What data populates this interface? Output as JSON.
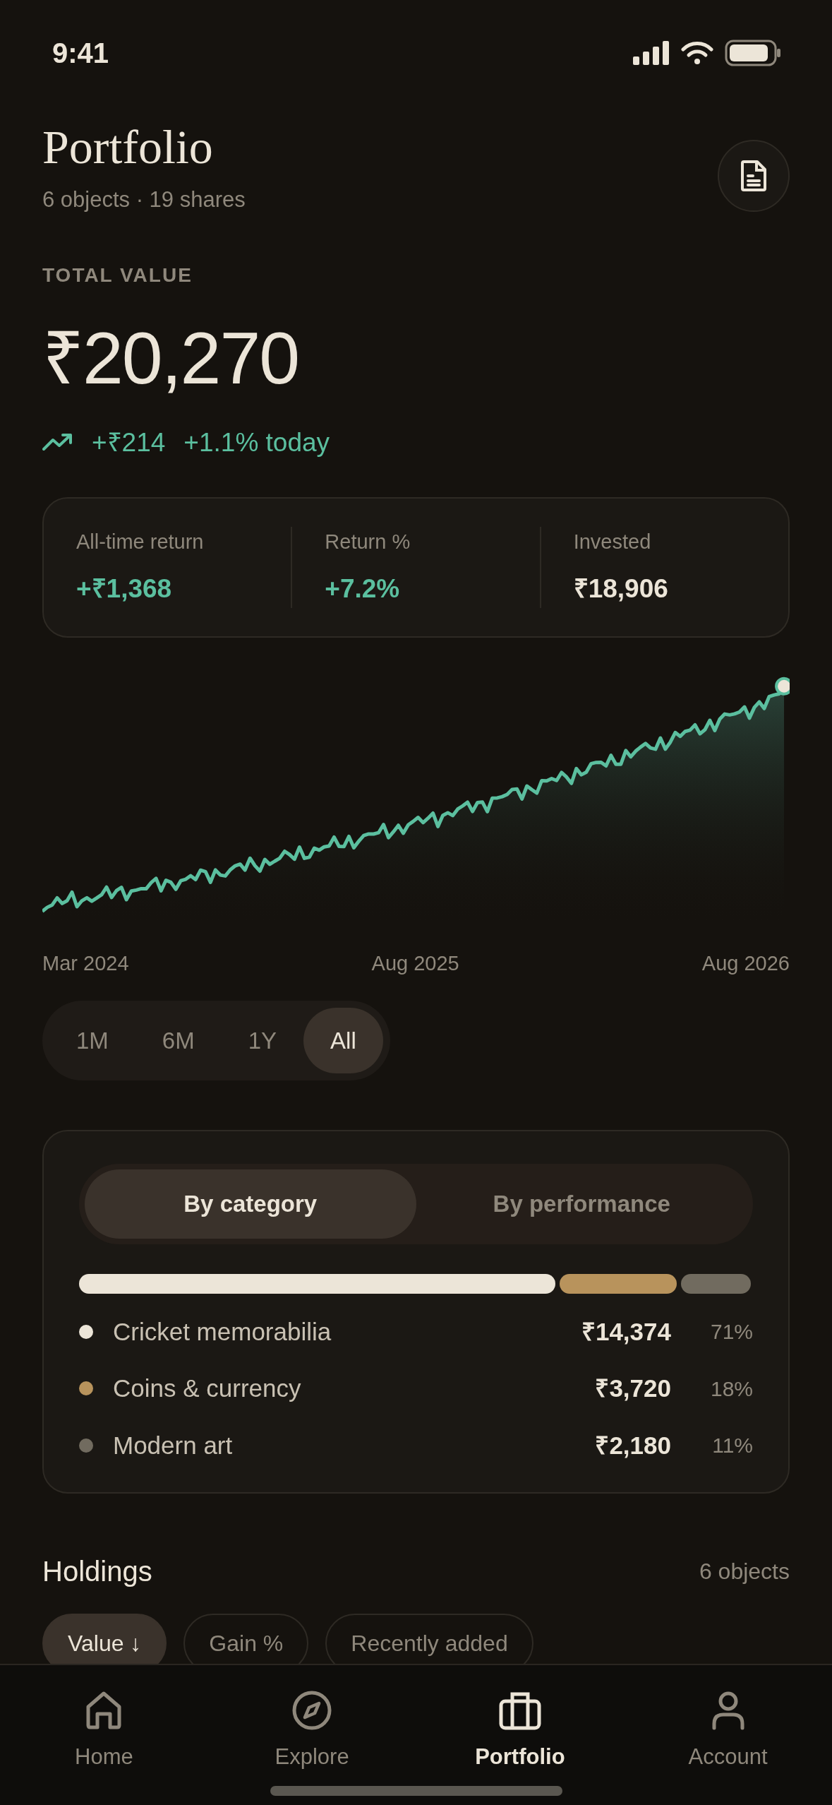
{
  "status_bar": {
    "time": "9:41"
  },
  "header": {
    "title": "Portfolio",
    "subtitle": "6 objects · 19 shares"
  },
  "total": {
    "label": "TOTAL VALUE",
    "value": "₹20,270",
    "change_amount": "+₹214",
    "change_percent": "+1.1% today"
  },
  "stats": [
    {
      "label": "All-time return",
      "value": "+₹1,368",
      "positive": true
    },
    {
      "label": "Return %",
      "value": "+7.2%",
      "positive": true
    },
    {
      "label": "Invested",
      "value": "₹18,906",
      "positive": false
    }
  ],
  "chart": {
    "kind": "picture",
    "x_labels": [
      "Mar 2024",
      "Aug 2025",
      "Aug 2026"
    ]
  },
  "ranges": [
    {
      "label": "1M",
      "selected": false
    },
    {
      "label": "6M",
      "selected": false
    },
    {
      "label": "1Y",
      "selected": false
    },
    {
      "label": "All",
      "selected": true
    }
  ],
  "allocation": {
    "tabs": [
      {
        "label": "By category",
        "selected": true
      },
      {
        "label": "By performance",
        "selected": false
      }
    ],
    "items": [
      {
        "name": "Cricket memorabilia",
        "value": "₹14,374",
        "percent": "71%",
        "color": "#ece5d8"
      },
      {
        "name": "Coins & currency",
        "value": "₹3,720",
        "percent": "18%",
        "color": "#b8935c"
      },
      {
        "name": "Modern art",
        "value": "₹2,180",
        "percent": "11%",
        "color": "#716b5f"
      }
    ]
  },
  "holdings": {
    "title": "Holdings",
    "count": "6 objects",
    "sorts": [
      {
        "label": "Value ↓",
        "selected": true
      },
      {
        "label": "Gain %",
        "selected": false
      },
      {
        "label": "Recently added",
        "selected": false
      }
    ]
  },
  "tab_bar": [
    {
      "label": "Home",
      "kind": "home",
      "selected": false
    },
    {
      "label": "Explore",
      "kind": "explore",
      "selected": false
    },
    {
      "label": "Portfolio",
      "kind": "portfolio",
      "selected": true
    },
    {
      "label": "Account",
      "kind": "account",
      "selected": false
    }
  ]
}
